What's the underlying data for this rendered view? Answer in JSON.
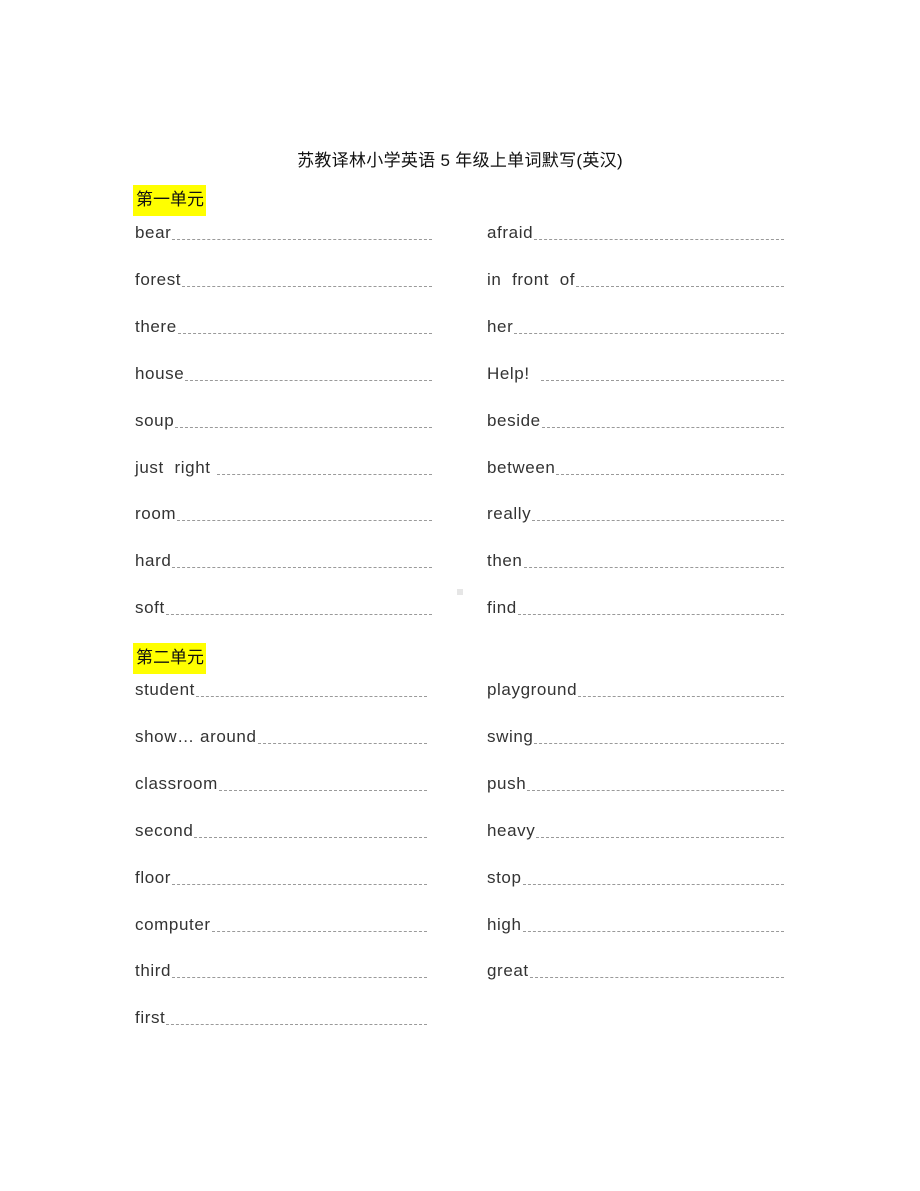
{
  "title": "苏教译林小学英语 5 年级上单词默写(英汉)",
  "units": [
    {
      "label": "第一单元",
      "left": [
        "bear",
        "forest",
        "there",
        "house",
        "soup",
        "just  right ",
        "room",
        "hard",
        "soft"
      ],
      "right": [
        "afraid",
        "in  front  of",
        "her",
        "Help!  ",
        "beside",
        "between",
        "really",
        "then",
        "find"
      ]
    },
    {
      "label": "第二单元",
      "left": [
        "student",
        "show… around",
        "classroom",
        "second",
        "floor",
        "computer",
        "third",
        "first"
      ],
      "right": [
        "playground",
        "swing",
        "push",
        "heavy",
        "stop",
        "high",
        "great"
      ]
    }
  ],
  "colors": {
    "highlight": "#ffff00",
    "text": "#333333"
  }
}
